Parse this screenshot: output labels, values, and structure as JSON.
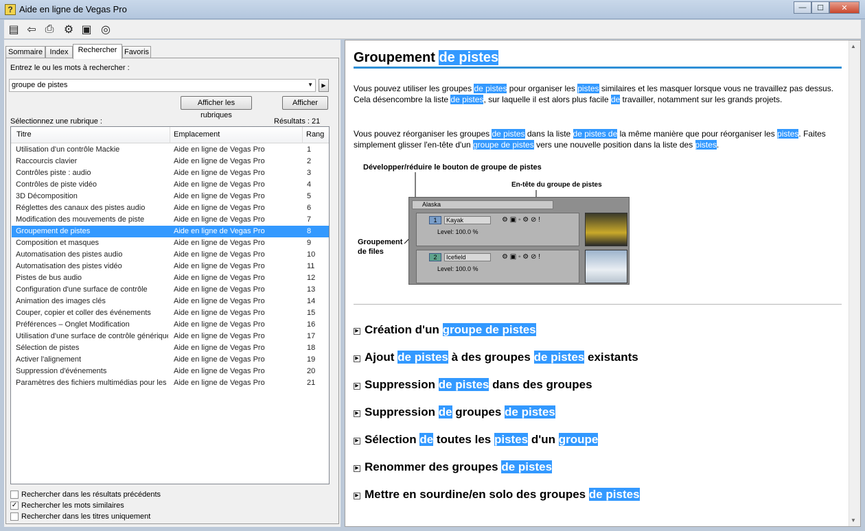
{
  "window": {
    "title": "Aide en ligne de Vegas Pro",
    "app_icon": "?",
    "min": "—",
    "max": "☐",
    "close": "✕"
  },
  "toolbar": {
    "icons": [
      "▤",
      "⇦",
      "⎙",
      "⚙",
      "▣",
      "◎"
    ]
  },
  "tabs": [
    {
      "label": "Sommaire"
    },
    {
      "label": "Index"
    },
    {
      "label": "Rechercher"
    },
    {
      "label": "Favoris"
    }
  ],
  "search": {
    "prompt": "Entrez le ou les mots à rechercher :",
    "value": "groupe de pistes",
    "dropdown_glyph": "▼",
    "go_glyph": "▶",
    "show_topics_button": "Afficher les rubriques",
    "show_button": "Afficher",
    "select_label": "Sélectionnez une rubrique :",
    "results": "Résultats : 21"
  },
  "table": {
    "headers": {
      "title": "Titre",
      "location": "Emplacement",
      "rank": "Rang"
    },
    "selected_index": 7,
    "rows": [
      {
        "title": "Utilisation d'un contrôle Mackie",
        "location": "Aide en ligne de Vegas Pro",
        "rank": "1"
      },
      {
        "title": "Raccourcis clavier",
        "location": "Aide en ligne de Vegas Pro",
        "rank": "2"
      },
      {
        "title": "Contrôles piste : audio",
        "location": "Aide en ligne de Vegas Pro",
        "rank": "3"
      },
      {
        "title": "Contrôles de piste vidéo",
        "location": "Aide en ligne de Vegas Pro",
        "rank": "4"
      },
      {
        "title": "3D Décomposition",
        "location": "Aide en ligne de Vegas Pro",
        "rank": "5"
      },
      {
        "title": "Réglettes des canaux des pistes audio",
        "location": "Aide en ligne de Vegas Pro",
        "rank": "6"
      },
      {
        "title": "Modification des mouvements de piste",
        "location": "Aide en ligne de Vegas Pro",
        "rank": "7"
      },
      {
        "title": "Groupement de pistes",
        "location": "Aide en ligne de Vegas Pro",
        "rank": "8"
      },
      {
        "title": "Composition et masques",
        "location": "Aide en ligne de Vegas Pro",
        "rank": "9"
      },
      {
        "title": "Automatisation des pistes audio",
        "location": "Aide en ligne de Vegas Pro",
        "rank": "10"
      },
      {
        "title": "Automatisation des pistes vidéo",
        "location": "Aide en ligne de Vegas Pro",
        "rank": "11"
      },
      {
        "title": "Pistes de bus audio",
        "location": "Aide en ligne de Vegas Pro",
        "rank": "12"
      },
      {
        "title": "Configuration d'une surface de contrôle",
        "location": "Aide en ligne de Vegas Pro",
        "rank": "13"
      },
      {
        "title": "Animation des images clés",
        "location": "Aide en ligne de Vegas Pro",
        "rank": "14"
      },
      {
        "title": "Couper, copier et coller des événements",
        "location": "Aide en ligne de Vegas Pro",
        "rank": "15"
      },
      {
        "title": "Préférences – Onglet Modification",
        "location": "Aide en ligne de Vegas Pro",
        "rank": "16"
      },
      {
        "title": "Utilisation d'une surface de contrôle générique",
        "location": "Aide en ligne de Vegas Pro",
        "rank": "17"
      },
      {
        "title": "Sélection de pistes",
        "location": "Aide en ligne de Vegas Pro",
        "rank": "18"
      },
      {
        "title": "Activer l'alignement",
        "location": "Aide en ligne de Vegas Pro",
        "rank": "19"
      },
      {
        "title": "Suppression d'événements",
        "location": "Aide en ligne de Vegas Pro",
        "rank": "20"
      },
      {
        "title": "Paramètres des fichiers multimédias pour les ...",
        "location": "Aide en ligne de Vegas Pro",
        "rank": "21"
      }
    ]
  },
  "options": [
    {
      "label": "Rechercher dans les résultats précédents",
      "checked": false
    },
    {
      "label": "Rechercher les mots similaires",
      "checked": true
    },
    {
      "label": "Rechercher dans les titres uniquement",
      "checked": false
    }
  ],
  "article": {
    "heading_plain": "Groupement",
    "heading_hl": "de pistes",
    "figure": {
      "callout_top": "Développer/réduire le bouton de groupe de pistes",
      "callout_header": "En-tête du groupe de pistes",
      "callout_left_1": "Groupement",
      "callout_left_2": "de files",
      "group_name": "Alaska",
      "track1": {
        "num": "1",
        "name": "Kayak",
        "level": "Level: 100.0 %"
      },
      "track2": {
        "num": "2",
        "name": "Icefield",
        "level": "Level: 100.0 %"
      }
    },
    "sections": [
      [
        {
          "t": "Création d'un "
        },
        {
          "t": "groupe de pistes",
          "h": true
        }
      ],
      [
        {
          "t": "Ajout "
        },
        {
          "t": "de pistes",
          "h": true
        },
        {
          "t": " à des groupes "
        },
        {
          "t": "de pistes",
          "h": true
        },
        {
          "t": " existants"
        }
      ],
      [
        {
          "t": "Suppression "
        },
        {
          "t": "de pistes",
          "h": true
        },
        {
          "t": " dans des groupes"
        }
      ],
      [
        {
          "t": "Suppression "
        },
        {
          "t": "de",
          "h": true
        },
        {
          "t": " groupes "
        },
        {
          "t": "de pistes",
          "h": true
        }
      ],
      [
        {
          "t": "Sélection "
        },
        {
          "t": "de",
          "h": true
        },
        {
          "t": " toutes les "
        },
        {
          "t": "pistes",
          "h": true
        },
        {
          "t": " d'un "
        },
        {
          "t": "groupe",
          "h": true
        }
      ],
      [
        {
          "t": "Renommer des groupes "
        },
        {
          "t": "de pistes",
          "h": true
        }
      ],
      [
        {
          "t": "Mettre en sourdine/en solo des groupes "
        },
        {
          "t": "de pistes",
          "h": true
        }
      ]
    ],
    "p1": [
      {
        "t": "Vous pouvez utiliser les groupes "
      },
      {
        "t": "de pistes",
        "h": true
      },
      {
        "t": " pour organiser les "
      },
      {
        "t": "pistes",
        "h": true
      },
      {
        "t": " similaires et les masquer lorsque vous ne travaillez pas dessus. Cela désencombre la liste "
      },
      {
        "t": "de pistes",
        "h": true
      },
      {
        "t": ", sur laquelle il est alors plus facile "
      },
      {
        "t": "de",
        "h": true
      },
      {
        "t": " travailler, notamment sur les grands projets."
      }
    ],
    "p2": [
      {
        "t": "Vous pouvez réorganiser les groupes "
      },
      {
        "t": "de pistes",
        "h": true
      },
      {
        "t": " dans la liste "
      },
      {
        "t": "de pistes de",
        "h": true
      },
      {
        "t": " la même manière que pour réorganiser les "
      },
      {
        "t": "pistes",
        "h": true
      },
      {
        "t": ". Faites simplement glisser l'en-tête d'un "
      },
      {
        "t": "groupe de pistes",
        "h": true
      },
      {
        "t": " vers une nouvelle position dans la liste des "
      },
      {
        "t": "pistes",
        "h": true
      },
      {
        "t": "."
      }
    ]
  }
}
